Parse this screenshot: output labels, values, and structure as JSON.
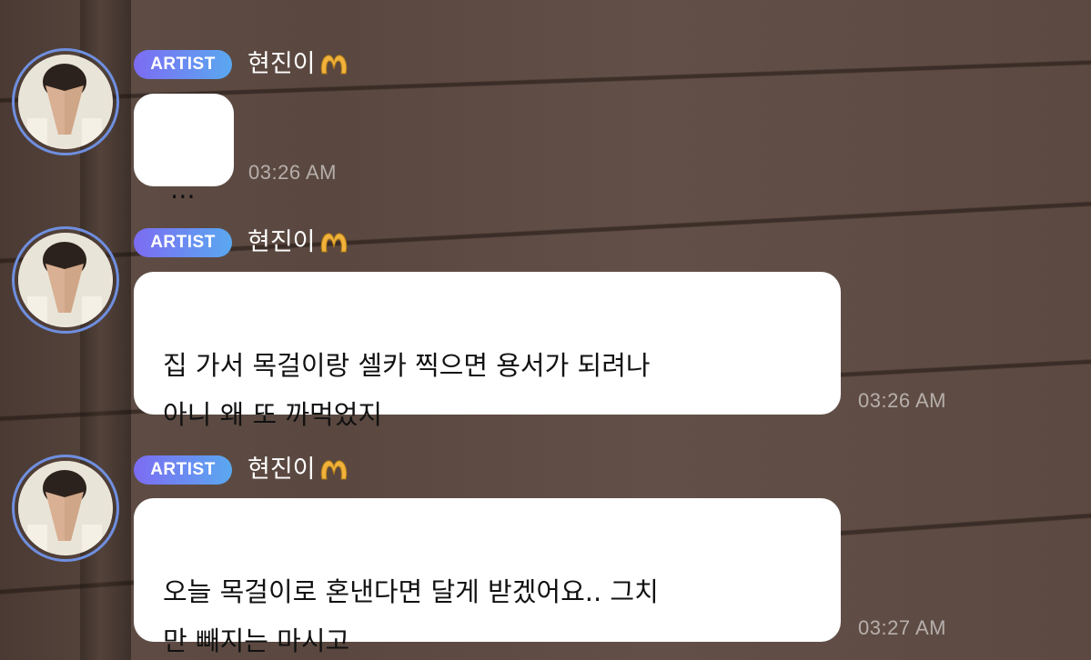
{
  "messages": [
    {
      "badge": "ARTIST",
      "sender": "현진이",
      "text": "...",
      "time": "03:26 AM"
    },
    {
      "badge": "ARTIST",
      "sender": "현진이",
      "text": "집 가서 목걸이랑 셀카 찍으면 용서가 되려나\n아니 왜 또 까먹었지",
      "time": "03:26 AM"
    },
    {
      "badge": "ARTIST",
      "sender": "현진이",
      "text": "오늘 목걸이로 혼낸다면 달게 받겠어요.. 그치\n만 빼지는 마시고",
      "time": "03:27 AM"
    }
  ],
  "colors": {
    "badge_gradient_start": "#7c6cf2",
    "badge_gradient_end": "#5aa8f0",
    "avatar_ring": "#6f8fe0",
    "bubble": "#ffffff",
    "heart_hands": "#f0b23a"
  },
  "icons": {
    "sender_emoji": "heart-hands-icon"
  }
}
